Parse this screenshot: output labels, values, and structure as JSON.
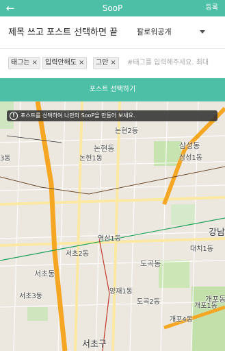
{
  "app_bar": {
    "back_icon": "arrow-left-icon",
    "back_glyph": "←",
    "title": "SooP",
    "action_label": "등록"
  },
  "post": {
    "title_value": "제목 쓰고 포스트 선택하면 끝",
    "visibility": "팔로워공개"
  },
  "tags": {
    "chips": [
      "태그는",
      "입력안해도",
      "그만"
    ],
    "remove_glyph": "×",
    "placeholder": "#태그를 입력해주세요. 최대"
  },
  "select_post_button": "포스트 선택하기",
  "banner": {
    "icon": "info-icon",
    "icon_glyph": "!",
    "message": "포스트를 선택하여 나만의 SooP을 만들어 보세요."
  },
  "map": {
    "labels": {
      "nonhyeon2": "논현2동",
      "nonhyeon_dong": "논현동",
      "nonhyeon1": "논현1동",
      "samseong_dong": "삼성동",
      "samseong1": "삼성1동",
      "gangnam": "강남",
      "yeoksam1": "역삼1동",
      "daechi1": "대치1동",
      "seocho2": "서초2동",
      "dogok_dong": "도곡동",
      "seocho_dong": "서초동",
      "yangjae1": "양재1동",
      "dogok2": "도곡2동",
      "seocho3": "서초3동",
      "gaepo1": "개포1동",
      "gaepo4": "개포4동",
      "gaepo_dong": "개포동",
      "seocho_gu": "서초구",
      "left_edge_3": "3동"
    }
  }
}
